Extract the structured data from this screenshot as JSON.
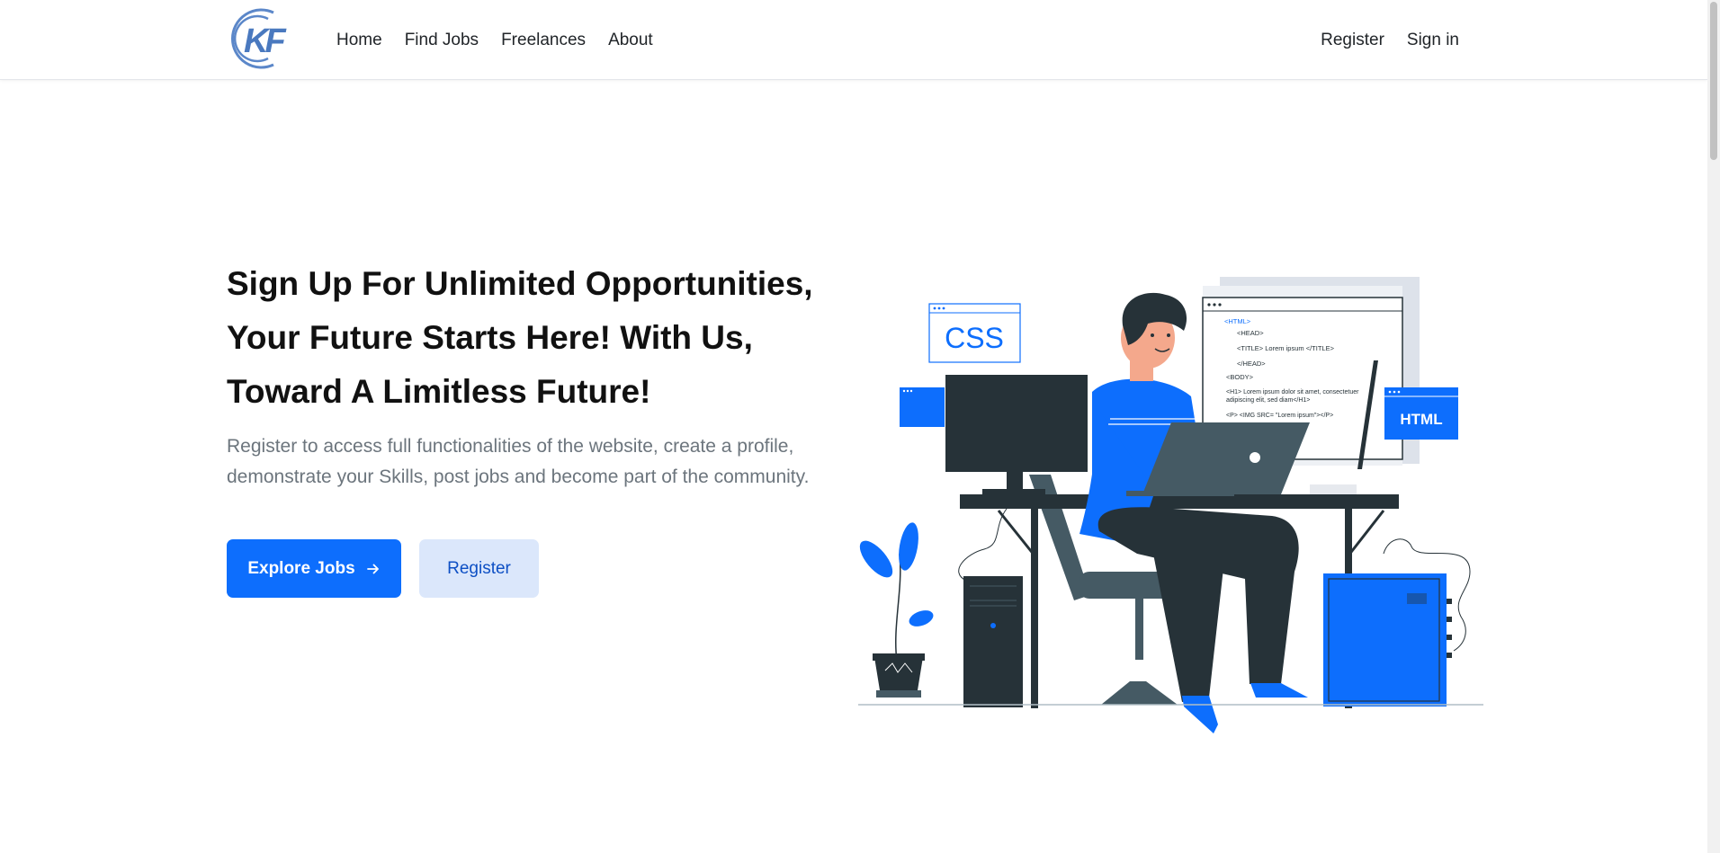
{
  "nav": {
    "logo_text": "KF",
    "links": [
      "Home",
      "Find Jobs",
      "Freelances",
      "About"
    ],
    "register": "Register",
    "sign_in": "Sign in"
  },
  "hero": {
    "title": "Sign Up For Unlimited Opportunities, Your Future Starts Here! With Us, Toward A Limitless Future!",
    "subtitle": "Register to access full functionalities of the website, create a profile, demonstrate your Skills, post jobs and become part of the community.",
    "primary_button": "Explore Jobs",
    "primary_button_icon": "arrow-right-icon",
    "secondary_button": "Register"
  },
  "illustration": {
    "css_tag": "CSS",
    "html_tag": "HTML",
    "code_lines": [
      "<HTML>",
      "<HEAD>",
      "<TITLE> Lorem ipsum </TITLE>",
      "</HEAD>",
      "<BODY>",
      "<H1> Lorem ipsum dolor sit amet, consectetuer",
      "adipiscing elit, sed diam</H1>",
      "<P> <IMG SRC= \"Lorem ipsum\"></P>"
    ]
  },
  "colors": {
    "primary": "#0d6efd",
    "dark": "#263238",
    "secondary_bg": "#dbe7fb"
  }
}
